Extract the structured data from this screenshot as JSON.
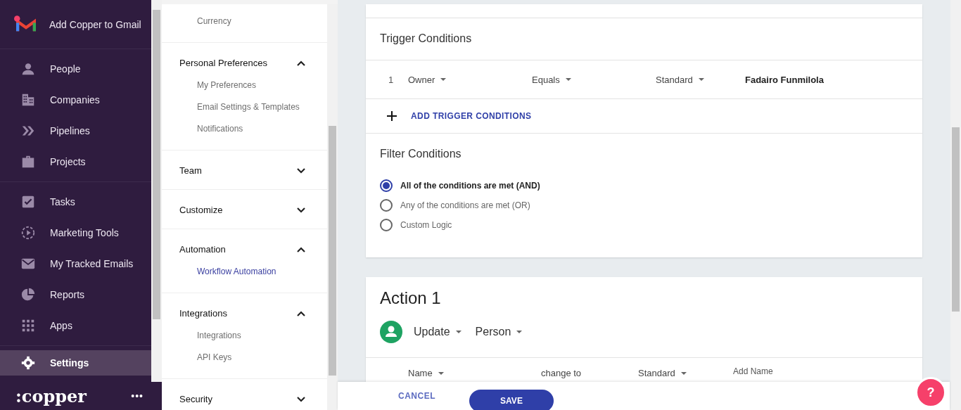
{
  "nav": {
    "promo": {
      "label": "Add Copper to Gmail"
    },
    "groups": [
      {
        "items": [
          {
            "label": "People",
            "kind": "person",
            "selected": false
          },
          {
            "label": "Companies",
            "kind": "building",
            "selected": false
          },
          {
            "label": "Pipelines",
            "kind": "chevrons",
            "selected": false
          },
          {
            "label": "Projects",
            "kind": "briefcase",
            "selected": false
          }
        ]
      },
      {
        "items": [
          {
            "label": "Tasks",
            "kind": "check",
            "selected": false
          },
          {
            "label": "Marketing Tools",
            "kind": "play",
            "selected": false
          },
          {
            "label": "My Tracked Emails",
            "kind": "mail",
            "selected": false
          },
          {
            "label": "Reports",
            "kind": "pie",
            "selected": false
          },
          {
            "label": "Apps",
            "kind": "grid",
            "selected": false
          }
        ]
      },
      {
        "items": [
          {
            "label": "Settings",
            "kind": "gear",
            "selected": true
          }
        ]
      }
    ],
    "logo": ":copper",
    "more": "•••"
  },
  "settings_menu": [
    {
      "items": [
        {
          "label": "Currency",
          "selected": false
        }
      ]
    },
    {
      "title": "Personal Preferences",
      "expanded": true,
      "items": [
        {
          "label": "My Preferences",
          "selected": false
        },
        {
          "label": "Email Settings & Templates",
          "selected": false
        },
        {
          "label": "Notifications",
          "selected": false
        }
      ]
    },
    {
      "title": "Team",
      "expanded": false
    },
    {
      "title": "Customize",
      "expanded": false
    },
    {
      "title": "Automation",
      "expanded": true,
      "items": [
        {
          "label": "Workflow Automation",
          "selected": true
        }
      ]
    },
    {
      "title": "Integrations",
      "expanded": true,
      "items": [
        {
          "label": "Integrations",
          "selected": false
        },
        {
          "label": "API Keys",
          "selected": false
        }
      ]
    },
    {
      "title": "Security",
      "expanded": false
    }
  ],
  "trigger": {
    "title": "Trigger Conditions",
    "rows": [
      {
        "number": "1",
        "field": "Owner",
        "operator": "Equals",
        "value_type": "Standard",
        "value": "Fadairo Funmilola"
      }
    ],
    "add_button": "ADD TRIGGER CONDITIONS"
  },
  "filter": {
    "title": "Filter Conditions",
    "options": [
      {
        "label": "All of the conditions are met (AND)",
        "selected": true
      },
      {
        "label": "Any of the conditions are met (OR)",
        "selected": false
      },
      {
        "label": "Custom Logic",
        "selected": false
      }
    ]
  },
  "action": {
    "title": "Action 1",
    "verb": "Update",
    "object": "Person",
    "rows": [
      {
        "field": "Name",
        "operator": "change to",
        "value_type": "Standard",
        "placeholder": "Add Name"
      }
    ]
  },
  "footer": {
    "cancel": "CANCEL",
    "save": "SAVE",
    "help": "?"
  }
}
